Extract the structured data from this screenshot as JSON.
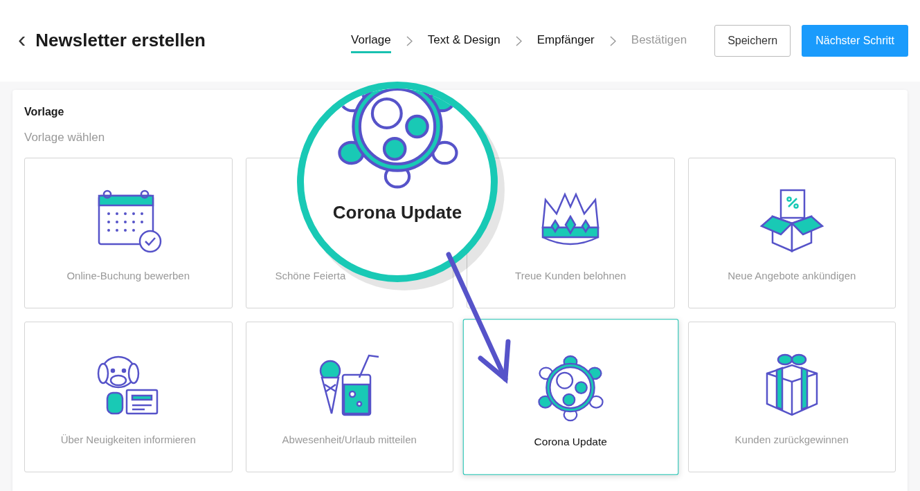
{
  "header": {
    "back": "‹",
    "title": "Newsletter erstellen"
  },
  "steps": [
    {
      "label": "Vorlage",
      "selected": true,
      "disabled": false
    },
    {
      "label": "Text & Design",
      "selected": false,
      "disabled": false
    },
    {
      "label": "Empfänger",
      "selected": false,
      "disabled": false
    },
    {
      "label": "Bestätigen",
      "selected": false,
      "disabled": true
    }
  ],
  "buttons": [
    {
      "label": "Speichern",
      "kind": "outline"
    },
    {
      "label": "Nächster Schritt",
      "kind": "primary"
    }
  ],
  "panel": {
    "title": "Vorlage",
    "subtitle": "Vorlage wählen"
  },
  "templates": [
    {
      "title": "Online-Buchung bewerben",
      "selected": false
    },
    {
      "title": "Schöne Feierta",
      "selected": false
    },
    {
      "title": "Treue Kunden belohnen",
      "selected": false
    },
    {
      "title": "Neue Angebote ankündigen",
      "selected": false
    },
    {
      "title": "Über Neuigkeiten informieren",
      "selected": false
    },
    {
      "title": "Abwesenheit/Urlaub mitteilen",
      "selected": false
    },
    {
      "title": "Corona Update",
      "selected": true
    },
    {
      "title": "Kunden zurückgewinnen",
      "selected": false
    }
  ],
  "magnifier": {
    "label": "Corona Update"
  }
}
